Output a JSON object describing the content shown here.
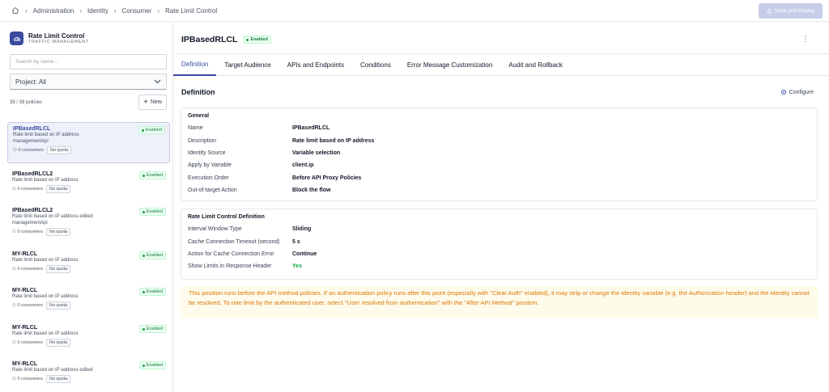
{
  "breadcrumb": [
    "Administration",
    "Identity",
    "Consumer",
    "Rate Limit Control"
  ],
  "deploy_label": "Save and Deploy",
  "app": {
    "title": "Rate Limit Control",
    "subtitle": "TRAFFIC MANAGEMENT"
  },
  "search": {
    "placeholder": "Search by name..."
  },
  "project": {
    "label": "Project: All"
  },
  "count": "39 / 39 policies",
  "new_label": "New",
  "items": [
    {
      "name": "IPBasedRLCL",
      "desc1": "Rate limit based on IP address",
      "desc2": "managementApi",
      "consumers": "0 consumers",
      "quota": "No quota",
      "status": "Enabled"
    },
    {
      "name": "IPBasedRLCL2",
      "desc1": "Rate limit based on IP address",
      "desc2": "",
      "consumers": "0 consumers",
      "quota": "No quota",
      "status": "Enabled"
    },
    {
      "name": "IPBasedRLCL2",
      "desc1": "Rate limit based on IP address edited",
      "desc2": "managementApi",
      "consumers": "0 consumers",
      "quota": "No quota",
      "status": "Enabled"
    },
    {
      "name": "MY-RLCL",
      "desc1": "Rate limit based on IP address",
      "desc2": "",
      "consumers": "0 consumers",
      "quota": "No quota",
      "status": "Enabled"
    },
    {
      "name": "MY-RLCL",
      "desc1": "Rate limit based on IP address",
      "desc2": "",
      "consumers": "0 consumers",
      "quota": "No quota",
      "status": "Enabled"
    },
    {
      "name": "MY-RLCL",
      "desc1": "Rate limit based on IP address",
      "desc2": "",
      "consumers": "0 consumers",
      "quota": "No quota",
      "status": "Enabled"
    },
    {
      "name": "MY-RLCL",
      "desc1": "Rate limit based on IP address edited",
      "desc2": "",
      "consumers": "0 consumers",
      "quota": "No quota",
      "status": "Enabled"
    }
  ],
  "detail": {
    "title": "IPBasedRLCL",
    "status": "Enabled",
    "tabs": [
      "Definition",
      "Target Audience",
      "APIs and Endpoints",
      "Conditions",
      "Error Message Customization",
      "Audit and Rollback"
    ],
    "section_title": "Definition",
    "configure_label": "Configure",
    "general": {
      "title": "General",
      "rows": [
        {
          "k": "Name",
          "v": "IPBasedRLCL"
        },
        {
          "k": "Description",
          "v": "Rate limit based on IP address"
        },
        {
          "k": "Identity Source",
          "v": "Variable selection"
        },
        {
          "k": "Apply by Variable",
          "v": "client.ip"
        },
        {
          "k": "Execution Order",
          "v": "Before API Proxy Policies"
        },
        {
          "k": "Out-of-target Action",
          "v": "Block the flow"
        }
      ]
    },
    "rlcd": {
      "title": "Rate Limit Control Definition",
      "rows": [
        {
          "k": "Interval Window Type",
          "v": "Sliding"
        },
        {
          "k": "Cache Connection Timeout (second)",
          "v": "5 s"
        },
        {
          "k": "Action for Cache Connection Error",
          "v": "Continue"
        },
        {
          "k": "Show Limits in Response Header",
          "v": "Yes"
        }
      ]
    },
    "warning": "This position runs before the API method policies. If an authentication policy runs after this point (especially with \"Clear Auth\" enabled), it may strip or change the identity variable (e.g. the Authorization header) and the identity cannot be resolved. To rate limit by the authenticated user, select \"User resolved from authentication\" with the \"After API Method\" position."
  },
  "colors": {
    "accent": "#3b4a9e",
    "success": "#16a34a",
    "warning": "#d97706"
  }
}
